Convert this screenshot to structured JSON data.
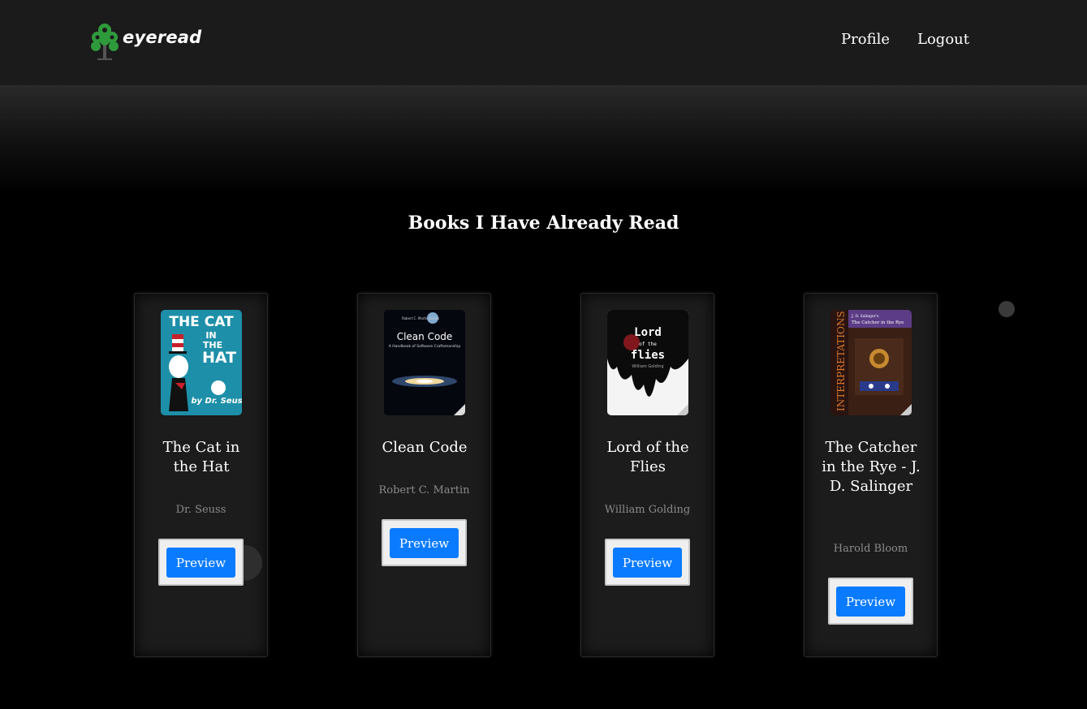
{
  "header": {
    "logo_text": "eyeread",
    "logo_icon": "tree-icon",
    "nav": [
      "Profile",
      "Logout"
    ]
  },
  "main": {
    "title": "Books I Have Already Read"
  },
  "books": [
    {
      "title": "The Cat in the Hat",
      "author": "Dr. Seuss",
      "button": "Preview",
      "cover_text": [
        "THE CAT",
        "IN",
        "THE",
        "HAT",
        "by Dr. Seuss"
      ]
    },
    {
      "title": "Clean Code",
      "author": "Robert C. Martin",
      "button": "Preview",
      "cover_text": [
        "Robert C. Martin Series",
        "Clean Code",
        "A Handbook of Software Craftsmanship"
      ]
    },
    {
      "title": "Lord of the Flies",
      "author": "William Golding",
      "button": "Preview",
      "cover_text": [
        "Lord",
        "of the",
        "flies",
        "William Golding"
      ]
    },
    {
      "title": "The Catcher in the Rye - J. D. Salinger",
      "author": "Harold Bloom",
      "button": "Preview",
      "cover_text": [
        "J. D. Salinger's",
        "The Catcher in the Rye",
        "INTERPRETATIONS"
      ]
    }
  ],
  "colors": {
    "navbar_bg": "#1b1b1b",
    "page_bg": "#000000",
    "card_bg": "#1c1c1c",
    "button_bg": "#0a7bff",
    "logo_green": "#2f9a3c"
  }
}
